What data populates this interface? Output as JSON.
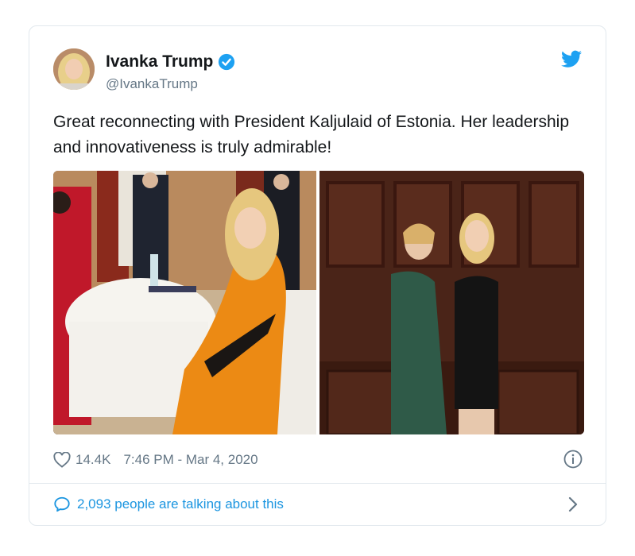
{
  "tweet": {
    "author": {
      "display_name": "Ivanka Trump",
      "handle": "@IvankaTrump",
      "verified": true
    },
    "text": "Great reconnecting with President Kaljulaid of Estonia.  Her leadership and innovativeness is truly admirable!",
    "likes": "14.4K",
    "timestamp": "7:46 PM - Mar 4, 2020",
    "conversation": "2,093 people are talking about this"
  },
  "icons": {
    "like": "heart-icon",
    "info": "info-icon",
    "reply": "speech-bubble-icon",
    "brand": "twitter-bird-icon",
    "verified": "verified-badge-icon",
    "chevron": "chevron-right-icon"
  },
  "colors": {
    "brand_blue": "#1da1f2",
    "link_blue": "#1b95e0",
    "secondary_text": "#657786",
    "primary_text": "#14171a",
    "border": "#e1e8ed"
  }
}
